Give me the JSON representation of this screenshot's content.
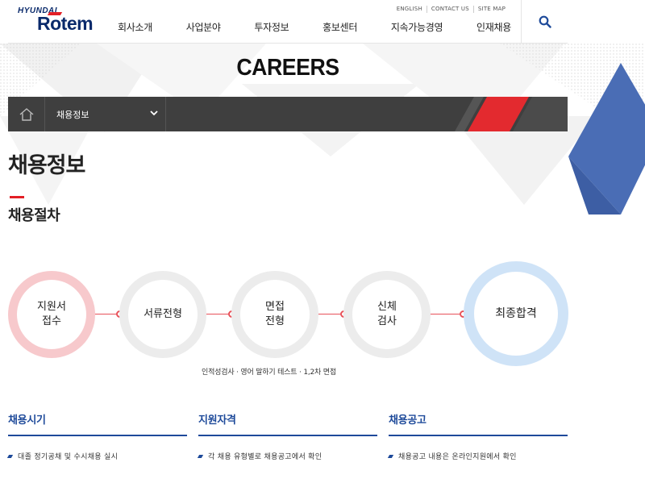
{
  "brand": {
    "logo_top": "HYUNDAI",
    "logo_main": "Rotem",
    "accent": "#1e4a9a",
    "red": "#e31f26"
  },
  "util_links": [
    "ENGLISH",
    "CONTACT US",
    "SITE MAP"
  ],
  "gnb": [
    "회사소개",
    "사업분야",
    "투자정보",
    "홍보센터",
    "지속가능경영",
    "인재채용"
  ],
  "page": {
    "title": "CAREERS"
  },
  "location": {
    "current": "채용정보"
  },
  "section": {
    "title": "채용정보",
    "subtitle": "채용절차"
  },
  "steps": [
    {
      "line1": "지원서",
      "line2": "접수"
    },
    {
      "line1": "서류전형",
      "line2": ""
    },
    {
      "line1": "면접",
      "line2": "전형"
    },
    {
      "line1": "신체",
      "line2": "검사"
    },
    {
      "line1": "최종합격",
      "line2": ""
    }
  ],
  "step_note": "인적성검사 · 영어 말하기 테스트 · 1,2차 면접",
  "columns": [
    {
      "title": "채용시기",
      "text": "대졸 정기공채 및 수시채용 실시"
    },
    {
      "title": "지원자격",
      "text": "각 채용 유형별로 채용공고에서 확인"
    },
    {
      "title": "채용공고",
      "text": "채용공고 내용은 온라인지원에서 확인"
    }
  ],
  "icons": {
    "search": "search-icon",
    "home": "home-icon",
    "chevron": "chevron-down-icon"
  }
}
